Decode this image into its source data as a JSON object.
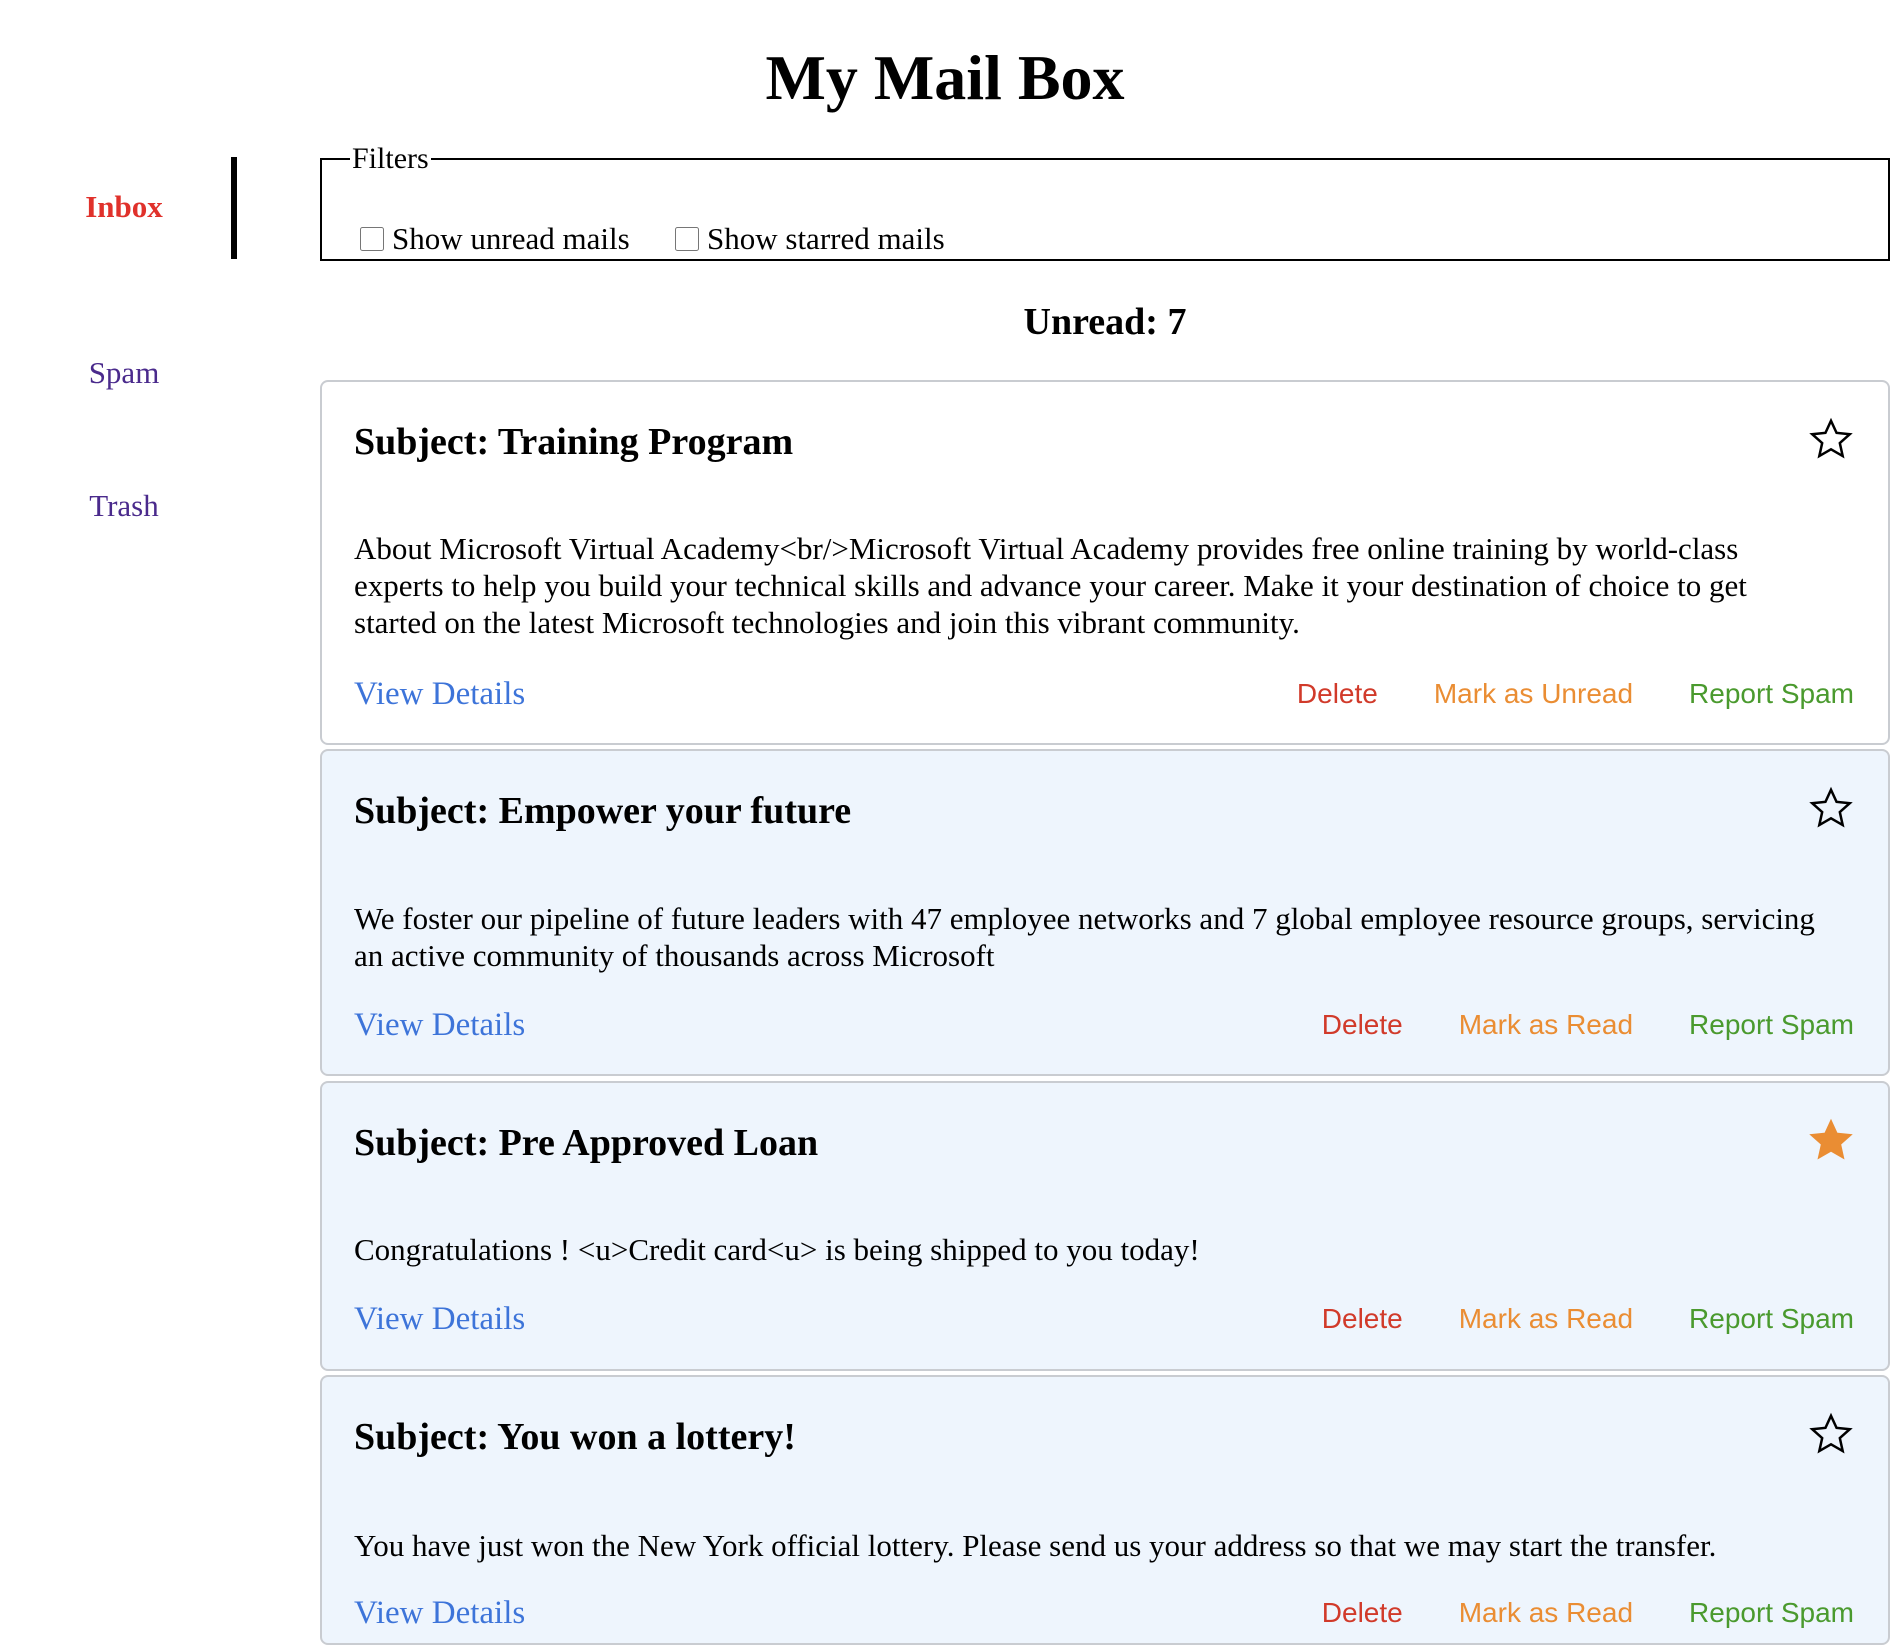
{
  "app": {
    "title": "My Mail Box"
  },
  "sidebar": {
    "items": [
      {
        "label": "Inbox",
        "active": true
      },
      {
        "label": "Spam",
        "active": false
      },
      {
        "label": "Trash",
        "active": false
      }
    ]
  },
  "filters": {
    "legend": "Filters",
    "unread_label": "Show unread mails",
    "unread_checked": false,
    "starred_label": "Show starred mails",
    "starred_checked": false
  },
  "summary": {
    "unread_text": "Unread: 7"
  },
  "colors": {
    "active_nav": "#e0312b",
    "nav": "#4a2a8c",
    "link": "#3d74d9",
    "delete": "#d13a2a",
    "mark": "#ea8d33",
    "spam": "#4a9a2e",
    "star_filled": "#ea8d33",
    "read_card_bg": "#eef5fd"
  },
  "mails": [
    {
      "subject": "Subject: Training Program",
      "body": "About Microsoft Virtual Academy<br/>Microsoft Virtual Academy provides free online training by world-class experts to help you build your technical skills and advance your career. Make it your destination of choice to get started on the latest Microsoft technologies and join this vibrant community.",
      "starred": false,
      "read": false,
      "view_label": "View Details",
      "delete_label": "Delete",
      "mark_label": "Mark as Unread",
      "spam_label": "Report Spam",
      "star_icon": "star-outline-icon"
    },
    {
      "subject": "Subject: Empower your future",
      "body": "We foster our pipeline of future leaders with 47 employee networks and 7 global employee resource groups, servicing an active community of thousands across Microsoft",
      "starred": false,
      "read": true,
      "view_label": "View Details",
      "delete_label": "Delete",
      "mark_label": "Mark as Read",
      "spam_label": "Report Spam",
      "star_icon": "star-outline-icon"
    },
    {
      "subject": "Subject: Pre Approved Loan",
      "body": "Congratulations ! <u>Credit card<u> is being shipped to you today!",
      "starred": true,
      "read": true,
      "view_label": "View Details",
      "delete_label": "Delete",
      "mark_label": "Mark as Read",
      "spam_label": "Report Spam",
      "star_icon": "star-filled-icon"
    },
    {
      "subject": "Subject: You won a lottery!",
      "body": "You have just won the New York official lottery. Please send us your address so that we may start the transfer.",
      "starred": false,
      "read": true,
      "view_label": "View Details",
      "delete_label": "Delete",
      "mark_label": "Mark as Read",
      "spam_label": "Report Spam",
      "star_icon": "star-outline-icon"
    }
  ]
}
